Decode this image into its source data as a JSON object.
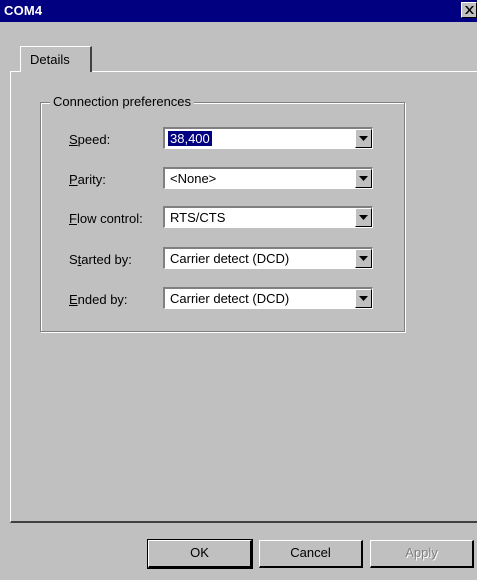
{
  "window": {
    "title": "COM4",
    "colors": {
      "titlebar": "#000080",
      "face": "#c0c0c0"
    }
  },
  "tabs": [
    {
      "label": "Details",
      "active": true
    }
  ],
  "group": {
    "title": "Connection preferences",
    "fields": [
      {
        "mnemonic": "S",
        "rest": "peed:",
        "value": "38,400",
        "focused": true
      },
      {
        "mnemonic": "P",
        "rest": "arity:",
        "value": "<None>",
        "focused": false
      },
      {
        "mnemonic": "F",
        "rest": "low control:",
        "value": "RTS/CTS",
        "focused": false
      },
      {
        "pre": "S",
        "mnemonic": "t",
        "rest": "arted by:",
        "value": "Carrier detect (DCD)",
        "focused": false
      },
      {
        "mnemonic": "E",
        "rest": "nded by:",
        "value": "Carrier detect (DCD)",
        "focused": false
      }
    ]
  },
  "buttons": {
    "ok": "OK",
    "cancel": "Cancel",
    "apply": "Apply"
  },
  "icons": {
    "close": "close-icon",
    "dropdown": "chevron-down-icon"
  }
}
